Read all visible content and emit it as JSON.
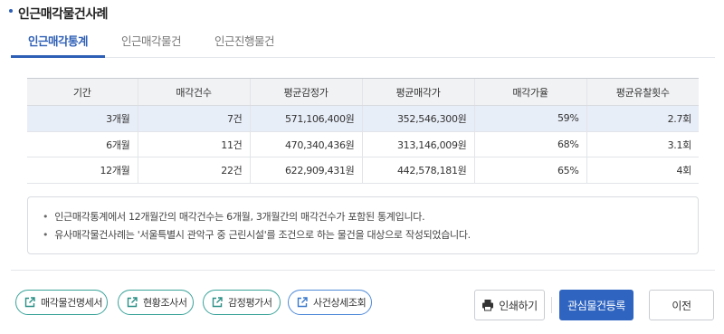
{
  "section_title": "인근매각물건사례",
  "tabs": [
    {
      "label": "인근매각통계"
    },
    {
      "label": "인근매각물건"
    },
    {
      "label": "인근진행물건"
    }
  ],
  "table": {
    "headers": [
      "기간",
      "매각건수",
      "평균감정가",
      "평균매각가",
      "매각가율",
      "평균유찰횟수"
    ],
    "rows": [
      [
        "3개월",
        "7건",
        "571,106,400원",
        "352,546,300원",
        "59%",
        "2.7회"
      ],
      [
        "6개월",
        "11건",
        "470,340,436원",
        "313,146,009원",
        "68%",
        "3.1회"
      ],
      [
        "12개월",
        "22건",
        "622,909,431원",
        "442,578,181원",
        "65%",
        "4회"
      ]
    ]
  },
  "notes": [
    "인근매각통계에서 12개월간의 매각건수는 6개월, 3개월간의 매각건수가 포함된 통계입니다.",
    "유사매각물건사례는 '서울특별시 관악구 중 근린시설'를 조건으로 하는 물건을 대상으로 작성되었습니다."
  ],
  "link_buttons": [
    {
      "label": "매각물건명세서",
      "icon": "external-link-icon"
    },
    {
      "label": "현황조사서",
      "icon": "external-link-icon"
    },
    {
      "label": "감정평가서",
      "icon": "external-link-icon"
    },
    {
      "label": "사건상세조회",
      "icon": "external-link-icon"
    }
  ],
  "actions": {
    "print_label": "인쇄하기",
    "print_icon": "printer-icon",
    "register_label": "관심물건등록",
    "prev_label": "이전"
  },
  "colors": {
    "accent": "#2f64c0",
    "highlight_row": "#e8eef8",
    "teal_border": "#3aa39a",
    "blue_border": "#4f8ad8"
  }
}
